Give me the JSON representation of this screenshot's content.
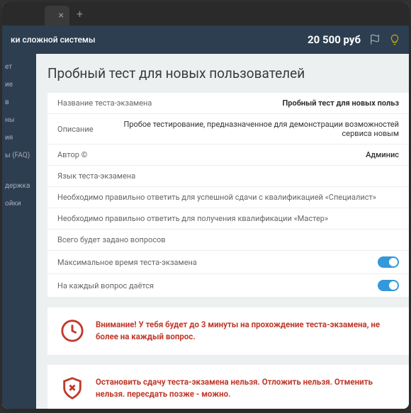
{
  "header": {
    "title_fragment": "ки сложной системы",
    "balance": "20 500 руб"
  },
  "sidebar": {
    "items": [
      {
        "label": "ет"
      },
      {
        "label": "ие"
      },
      {
        "label": "в"
      },
      {
        "label": "ны"
      },
      {
        "label": "ия"
      },
      {
        "label": "ы (FAQ)"
      },
      {
        "label": "держка"
      },
      {
        "label": "ойки"
      }
    ]
  },
  "page": {
    "title": "Пробный тест для новых пользователей"
  },
  "rows": [
    {
      "label": "Название теста-экзамена",
      "value": "Пробный тест для новых польз"
    },
    {
      "label": "Описание",
      "value": "Пробое тестирование, предназначенное для демонстрации возможностей сервиса новым"
    },
    {
      "label": "Автор ©",
      "value": "Админис"
    },
    {
      "label": "Язык теста-экзамена",
      "value": ""
    },
    {
      "label": "Необходимо правильно ответить для успешной сдачи с квалификацией «Специалист»",
      "value": ""
    },
    {
      "label": "Необходимо правильно ответить для получения квалификации «Мастер»",
      "value": ""
    },
    {
      "label": "Всего будет задано вопросов",
      "value": ""
    },
    {
      "label": "Максимальное время теста-экзамена",
      "value": ""
    },
    {
      "label": "На каждый вопрос даётся",
      "value": ""
    }
  ],
  "warnings": [
    {
      "text": "Внимание! У тебя будет до 3 минуты на прохождение теста-экзамена, не более на каждый вопрос."
    },
    {
      "text": "Остановить сдачу теста-экзамена нельзя. Отложить нельзя. Отменить нельзя. пересдать позже - можно."
    }
  ]
}
